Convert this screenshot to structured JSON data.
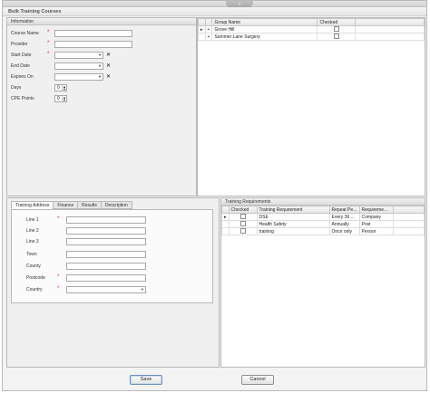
{
  "window": {
    "title": "Bulk Training Courses",
    "collapse_icon": "chevron-down-icon"
  },
  "information": {
    "title": "Information",
    "fields": {
      "course_name": {
        "label": "Course Name",
        "value": ""
      },
      "provider": {
        "label": "Provider",
        "value": ""
      },
      "start_date": {
        "label": "Start Date",
        "value": ""
      },
      "end_date": {
        "label": "End Date",
        "value": ""
      },
      "expires_on": {
        "label": "Expires On",
        "value": ""
      },
      "days": {
        "label": "Days",
        "value": "0"
      },
      "cpe_points": {
        "label": "CPE Points",
        "value": "0"
      }
    }
  },
  "groups_grid": {
    "columns": [
      "Group Name",
      "Checked"
    ],
    "rows": [
      {
        "name": "Grove Hill",
        "checked": false,
        "current": true
      },
      {
        "name": "Summer Lane Surgery",
        "checked": false,
        "current": false
      }
    ]
  },
  "tabs": [
    "Training Address",
    "Finance",
    "Results",
    "Description"
  ],
  "address": {
    "line1": {
      "label": "Line 1",
      "value": ""
    },
    "line2": {
      "label": "Line 2",
      "value": ""
    },
    "line3": {
      "label": "Line 3",
      "value": ""
    },
    "town": {
      "label": "Town",
      "value": ""
    },
    "county": {
      "label": "County",
      "value": ""
    },
    "postcode": {
      "label": "Postcode",
      "value": ""
    },
    "country": {
      "label": "Country",
      "value": ""
    }
  },
  "requirements": {
    "title": "Training Requirements",
    "columns": [
      "Checked",
      "Training Requirement",
      "Repeat Pe...",
      "Requireme..."
    ],
    "rows": [
      {
        "name": "DSE",
        "repeat": "Every 36 ...",
        "requirement": "Company",
        "checked": false,
        "current": true
      },
      {
        "name": "Health Safety",
        "repeat": "Annually",
        "requirement": "Post",
        "checked": false,
        "current": false
      },
      {
        "name": "training",
        "repeat": "Once only",
        "requirement": "Person",
        "checked": false,
        "current": false
      }
    ]
  },
  "buttons": {
    "save": "Save",
    "cancel": "Cancel"
  },
  "colors": {
    "required": "#e02020",
    "focus_border": "#6a8fbf"
  }
}
